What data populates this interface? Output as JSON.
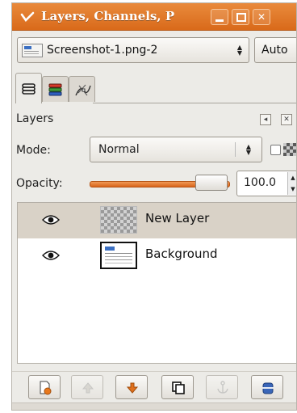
{
  "window": {
    "title": "Layers, Channels, P",
    "icons": {
      "window_menu": "gimp-brush-icon",
      "minimize": "minimize-icon",
      "maximize": "maximize-icon",
      "close": "close-icon"
    }
  },
  "image_selector": {
    "selected_image": "Screenshot-1.png-2",
    "auto_button": "Auto"
  },
  "dock_tabs": [
    {
      "icon": "layers-icon",
      "active": true
    },
    {
      "icon": "channels-icon",
      "active": false
    },
    {
      "icon": "paths-icon",
      "active": false
    }
  ],
  "layers_panel": {
    "title": "Layers",
    "mode_label": "Mode:",
    "mode_value": "Normal",
    "lock_alpha_checked": false,
    "opacity_label": "Opacity:",
    "opacity_value": "100.0",
    "opacity_percent": 100,
    "layers": [
      {
        "name": "New Layer",
        "visible": true,
        "selected": true,
        "thumbnail": "transparent-checker"
      },
      {
        "name": "Background",
        "visible": true,
        "selected": false,
        "thumbnail": "screenshot-preview"
      }
    ]
  },
  "bottom_toolbar": [
    {
      "name": "new-layer-button",
      "icon": "new-layer-icon",
      "enabled": true
    },
    {
      "name": "raise-layer-button",
      "icon": "arrow-up-icon",
      "enabled": false
    },
    {
      "name": "lower-layer-button",
      "icon": "arrow-down-icon",
      "enabled": true
    },
    {
      "name": "duplicate-layer-button",
      "icon": "duplicate-icon",
      "enabled": true
    },
    {
      "name": "anchor-layer-button",
      "icon": "anchor-icon",
      "enabled": false
    },
    {
      "name": "delete-layer-button",
      "icon": "delete-icon",
      "enabled": true
    }
  ],
  "colors": {
    "titlebar": "#d96a1a",
    "slider_fill": "#e27a30",
    "selected_row": "#d9d2c7",
    "arrow_down_icon": "#e0701c"
  }
}
